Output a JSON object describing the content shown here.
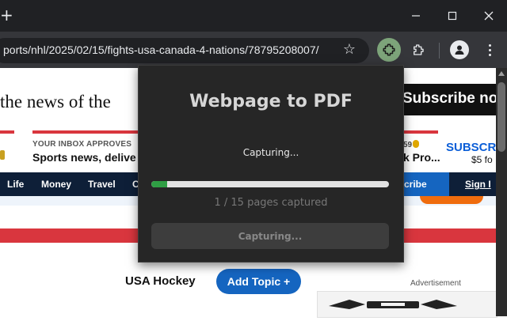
{
  "browser": {
    "new_tab_glyph": "+",
    "url": "ports/nhl/2025/02/15/fights-usa-canada-4-nations/78795208007/",
    "icons": [
      "new-tab-icon",
      "minimize-icon",
      "maximize-icon",
      "close-icon",
      "bookmark-star-icon",
      "extension-active-icon",
      "extensions-puzzle-icon",
      "profile-icon",
      "menu-kebab-icon"
    ],
    "accent_color": "#7da47a"
  },
  "page": {
    "headline_partial": "the news of the",
    "subscribe_top": "Subscribe no",
    "inbox_kicker": "YOUR INBOX APPROVES",
    "inbox_title": "Sports news, delive",
    "promo_price": "59",
    "promo_text": "k Pro...",
    "subscribe_blue": "SUBSCR",
    "subscribe_price": "$5 fo",
    "nav": {
      "items": [
        "Life",
        "Money",
        "Travel",
        "C"
      ],
      "subscribe": "bscribe",
      "signin": "Sign I"
    },
    "usa_hockey": "USA Hockey",
    "add_topic": "Add Topic +",
    "ad_label": "Advertisement",
    "brand_color": "#1565c0",
    "nav_color": "#0e1f38",
    "red_color": "#d9363e"
  },
  "popup": {
    "title": "Webpage to PDF",
    "status": "Capturing...",
    "progress_captured": 1,
    "progress_total": 15,
    "progress_fraction": 0.0667,
    "count_text": "1 / 15 pages captured",
    "button_label": "Capturing...",
    "progress_color": "#2f9e44"
  }
}
